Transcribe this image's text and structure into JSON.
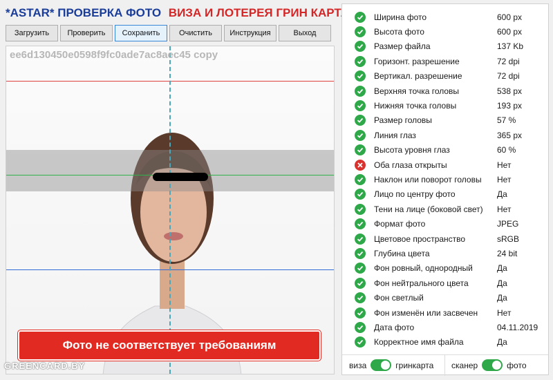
{
  "header": {
    "brand": "*ASTAR* ПРОВЕРКА ФОТО",
    "subtitle": "ВИЗА И ЛОТЕРЕЯ ГРИН КАРТА"
  },
  "toolbar": {
    "load": "Загрузить",
    "check": "Проверить",
    "save": "Сохранить",
    "clear": "Очистить",
    "manual": "Инструкция",
    "exit": "Выход"
  },
  "photo": {
    "filename": "ee6d130450e0598f9fc0ade7ac8aec45 copy",
    "warning": "Фото не соответствует требованиям",
    "watermark": "GREENCARD.BY"
  },
  "checks": [
    {
      "label": "Ширина фото",
      "value": "600 px",
      "ok": true
    },
    {
      "label": "Высота фото",
      "value": "600 px",
      "ok": true
    },
    {
      "label": "Размер файла",
      "value": "137 Kb",
      "ok": true
    },
    {
      "label": "Горизонт. разрешение",
      "value": "72 dpi",
      "ok": true
    },
    {
      "label": "Вертикал. разрешение",
      "value": "72 dpi",
      "ok": true
    },
    {
      "label": "Верхняя точка головы",
      "value": "538 px",
      "ok": true
    },
    {
      "label": "Нижняя точка головы",
      "value": "193 px",
      "ok": true
    },
    {
      "label": "Размер головы",
      "value": "57 %",
      "ok": true
    },
    {
      "label": "Линия глаз",
      "value": "365 px",
      "ok": true
    },
    {
      "label": "Высота уровня глаз",
      "value": "60 %",
      "ok": true
    },
    {
      "label": "Оба глаза открыты",
      "value": "Нет",
      "ok": false
    },
    {
      "label": "Наклон или поворот головы",
      "value": "Нет",
      "ok": true
    },
    {
      "label": "Лицо по центру фото",
      "value": "Да",
      "ok": true
    },
    {
      "label": "Тени на лице (боковой свет)",
      "value": "Нет",
      "ok": true
    },
    {
      "label": "Формат фото",
      "value": "JPEG",
      "ok": true
    },
    {
      "label": "Цветовое пространство",
      "value": "sRGB",
      "ok": true
    },
    {
      "label": "Глубина цвета",
      "value": "24 bit",
      "ok": true
    },
    {
      "label": "Фон ровный, однородный",
      "value": "Да",
      "ok": true
    },
    {
      "label": "Фон нейтрального цвета",
      "value": "Да",
      "ok": true
    },
    {
      "label": "Фон светлый",
      "value": "Да",
      "ok": true
    },
    {
      "label": "Фон изменён или засвечен",
      "value": "Нет",
      "ok": true
    },
    {
      "label": "Дата фото",
      "value": "04.11.2019",
      "ok": true
    },
    {
      "label": "Корректное имя файла",
      "value": "Да",
      "ok": true
    }
  ],
  "toggles": {
    "mode_left": "виза",
    "mode_right": "гринкарта",
    "src_left": "сканер",
    "src_right": "фото"
  },
  "colors": {
    "ok": "#2fa84a",
    "fail": "#d9332f",
    "brand": "#1a3d9a",
    "accent": "#d42626"
  }
}
